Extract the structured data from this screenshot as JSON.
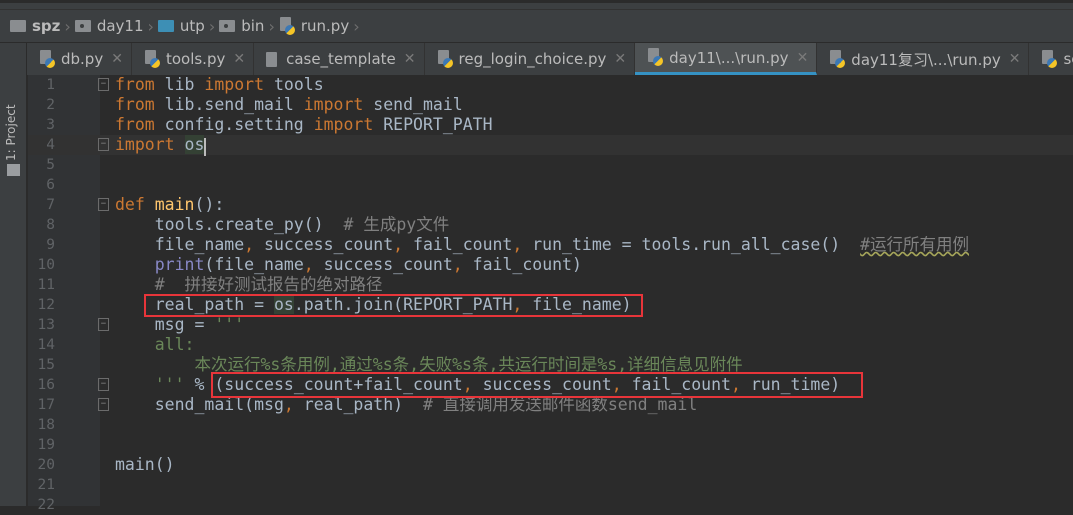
{
  "breadcrumb": [
    "spz",
    "day11",
    "utp",
    "bin",
    "run.py"
  ],
  "tool_strip": {
    "project_label": "1: Project"
  },
  "tabs": [
    {
      "label": "db.py",
      "icon": "python-file-icon",
      "active": false
    },
    {
      "label": "tools.py",
      "icon": "python-file-icon",
      "active": false
    },
    {
      "label": "case_template",
      "icon": "text-file-icon",
      "active": false
    },
    {
      "label": "reg_login_choice.py",
      "icon": "python-file-icon",
      "active": false
    },
    {
      "label": "day11\\...\\run.py",
      "icon": "python-file-icon",
      "active": true
    },
    {
      "label": "day11复习\\...\\run.py",
      "icon": "python-file-icon",
      "active": false
    },
    {
      "label": "sett",
      "icon": "python-file-icon",
      "active": false
    }
  ],
  "editor": {
    "current_line": 4,
    "lines": [
      {
        "n": "1",
        "fold": true,
        "tokens": [
          [
            "k",
            "from "
          ],
          [
            "",
            "lib "
          ],
          [
            "k",
            "import "
          ],
          [
            "",
            "tools"
          ]
        ]
      },
      {
        "n": "2",
        "tokens": [
          [
            "k",
            "from "
          ],
          [
            "",
            "lib.send_mail "
          ],
          [
            "k",
            "import "
          ],
          [
            "",
            "send_mail"
          ]
        ]
      },
      {
        "n": "3",
        "tokens": [
          [
            "k",
            "from "
          ],
          [
            "",
            "config.setting "
          ],
          [
            "k",
            "import "
          ],
          [
            "",
            "REPORT_PATH"
          ]
        ]
      },
      {
        "n": "4",
        "fold": true,
        "tokens": [
          [
            "k",
            "import "
          ],
          [
            "hl",
            "os"
          ]
        ]
      },
      {
        "n": "5",
        "tokens": []
      },
      {
        "n": "6",
        "tokens": []
      },
      {
        "n": "7",
        "fold": true,
        "tokens": [
          [
            "k",
            "def "
          ],
          [
            "f",
            "main"
          ],
          [
            "",
            "():"
          ]
        ]
      },
      {
        "n": "8",
        "tokens": [
          [
            "",
            "    tools.create_py()  "
          ],
          [
            "c",
            "# 生成py文件"
          ]
        ]
      },
      {
        "n": "9",
        "tokens": [
          [
            "",
            "    file_name"
          ],
          [
            "k",
            ", "
          ],
          [
            "",
            "success_count"
          ],
          [
            "k",
            ", "
          ],
          [
            "",
            "fail_count"
          ],
          [
            "k",
            ", "
          ],
          [
            "",
            "run_time = tools.run_all_case()  "
          ],
          [
            "sc",
            "#运行所有用例"
          ]
        ]
      },
      {
        "n": "10",
        "tokens": [
          [
            "",
            "    "
          ],
          [
            "b",
            "print"
          ],
          [
            "",
            "(file_name"
          ],
          [
            "k",
            ", "
          ],
          [
            "",
            "success_count"
          ],
          [
            "k",
            ", "
          ],
          [
            "",
            "fail_count)"
          ]
        ]
      },
      {
        "n": "11",
        "tokens": [
          [
            "c",
            "    #  拼接好测试报告的绝对路径"
          ]
        ]
      },
      {
        "n": "12",
        "tokens": [
          [
            "",
            "    real_path = "
          ],
          [
            "hl",
            "os"
          ],
          [
            "",
            ".path.join(REPORT_PATH"
          ],
          [
            "k",
            ", "
          ],
          [
            "",
            "file_name)"
          ]
        ]
      },
      {
        "n": "13",
        "fold": true,
        "tokens": [
          [
            "",
            "    msg = "
          ],
          [
            "s",
            "'''"
          ]
        ]
      },
      {
        "n": "14",
        "tokens": [
          [
            "s",
            "    all:"
          ]
        ]
      },
      {
        "n": "15",
        "tokens": [
          [
            "s",
            "        本次运行%s条用例,通过%s条,失败%s条,共运行时间是%s,详细信息见附件"
          ]
        ]
      },
      {
        "n": "16",
        "fold": true,
        "tokens": [
          [
            "s",
            "    '''"
          ],
          [
            "",
            " % (success_count+fail_count"
          ],
          [
            "k",
            ", "
          ],
          [
            "",
            "success_count"
          ],
          [
            "k",
            ", "
          ],
          [
            "",
            "fail_count"
          ],
          [
            "k",
            ", "
          ],
          [
            "",
            "run_time)"
          ]
        ]
      },
      {
        "n": "17",
        "fold": true,
        "tokens": [
          [
            "",
            "    send_mail(msg"
          ],
          [
            "k",
            ", "
          ],
          [
            "",
            "real_path)  "
          ],
          [
            "c",
            "# 直接调用发送邮件函数send_mail"
          ]
        ]
      },
      {
        "n": "18",
        "tokens": []
      },
      {
        "n": "19",
        "tokens": []
      },
      {
        "n": "20",
        "tokens": [
          [
            "",
            "main()"
          ]
        ]
      },
      {
        "n": "21",
        "tokens": []
      },
      {
        "n": "22",
        "tokens": []
      }
    ]
  },
  "colors": {
    "keyword": "#cc7832",
    "text": "#a9b7c6",
    "comment": "#808080",
    "string": "#6a8759",
    "function": "#ffc66d",
    "builtin": "#8888c6",
    "highlight_box": "#e8353a",
    "active_tab": "#3592c4"
  }
}
